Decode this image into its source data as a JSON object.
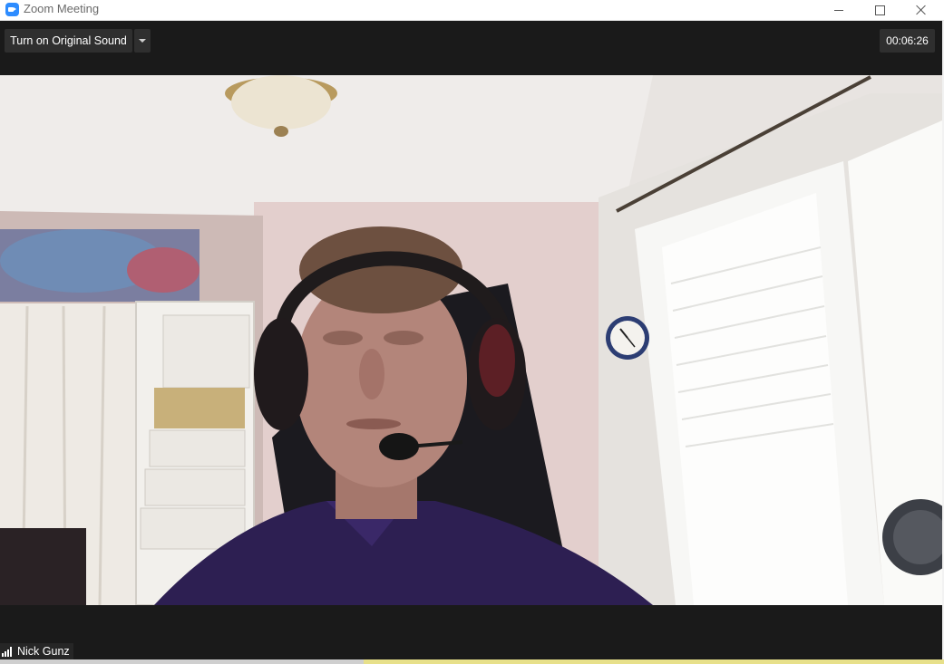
{
  "window": {
    "title": "Zoom Meeting",
    "icon": "zoom-camera-icon",
    "controls": [
      "minimize-icon",
      "maximize-icon",
      "close-icon"
    ]
  },
  "toolbar": {
    "original_sound_label": "Turn on Original Sound",
    "original_sound_menu_icon": "chevron-down-icon",
    "timer": "00:06:26"
  },
  "participant": {
    "name": "Nick Gunz",
    "icon": "signal-strength-icon"
  },
  "colors": {
    "background": "#1a1a1a",
    "button": "#2f2f2f",
    "text": "#ffffff",
    "accent": "#2d8cff"
  }
}
